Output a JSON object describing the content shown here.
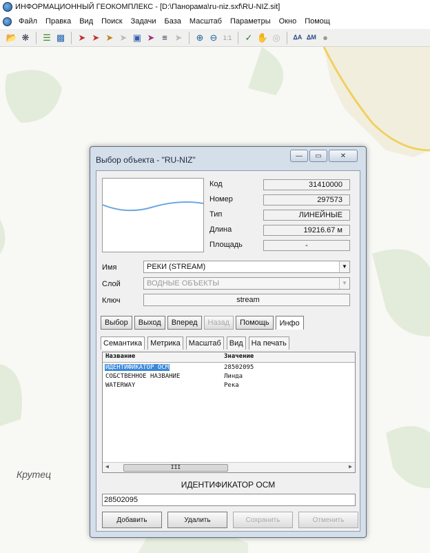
{
  "window": {
    "title": "ИНФОРМАЦИОННЫЙ ГЕОКОМПЛЕКС - [D:\\Панорама\\ru-niz.sxf\\RU-NIZ.sit]",
    "app_icon": "globe-icon"
  },
  "menu": {
    "items": [
      "Файл",
      "Правка",
      "Вид",
      "Поиск",
      "Задачи",
      "База",
      "Масштаб",
      "Параметры",
      "Окно",
      "Помощ"
    ]
  },
  "toolbar": {
    "icons": [
      "open-folder-icon",
      "bug-icon",
      "layers-icon",
      "document-icon",
      "select-arrow-icon",
      "select-multi-icon",
      "select-area-icon",
      "select-disabled-icon",
      "select-rect-icon",
      "select-obj-icon",
      "list-icon",
      "select-off-icon",
      "zoom-in-icon",
      "zoom-out-icon",
      "zoom-actual-icon",
      "check-tool-icon",
      "hand-pan-icon",
      "target-icon",
      "text-tool-icon",
      "measure-tool-icon",
      "circle-icon"
    ],
    "zoom_actual_label": "1:1"
  },
  "map": {
    "place_label": "Крутец",
    "fill_color": "#dfe8d6",
    "road_color": "#f0d060"
  },
  "dialog": {
    "title": "Выбор объекта - \"RU-NIZ\"",
    "controls": {
      "minimize": "—",
      "restore": "▭",
      "close": "✕"
    },
    "props": [
      {
        "label": "Код",
        "value": "31410000"
      },
      {
        "label": "Номер",
        "value": "297573"
      },
      {
        "label": "Тип",
        "value": "ЛИНЕЙНЫЕ"
      },
      {
        "label": "Длина",
        "value": "19216.67 м"
      },
      {
        "label": "Площадь",
        "value": "-"
      }
    ],
    "name_label": "Имя",
    "name_value": "РЕКИ (STREAM)",
    "layer_label": "Слой",
    "layer_value": "ВОДНЫЕ ОБЪЕКТЫ",
    "key_label": "Ключ",
    "key_value": "stream",
    "buttons": {
      "select": "Выбор",
      "exit": "Выход",
      "forward": "Вперед",
      "back": "Назад",
      "help": "Помощь",
      "info": "Инфо"
    },
    "tabs": [
      "Семантика",
      "Метрика",
      "Масштаб",
      "Вид",
      "На печать"
    ],
    "table": {
      "headers": [
        "Название",
        "Значение"
      ],
      "rows": [
        {
          "name": "ИДЕНТИФИКАТОР ОСМ",
          "value": "28502095"
        },
        {
          "name": "СОБСТВЕННОЕ НАЗВАНИЕ",
          "value": "Линда"
        },
        {
          "name": "WATERWAY",
          "value": "Река"
        }
      ],
      "scroll_thumb": "III"
    },
    "selected_attr_name": "ИДЕНТИФИКАТОР ОСМ",
    "selected_attr_value": "28502095",
    "bottom_buttons": {
      "add": "Добавить",
      "delete": "Удалить",
      "save": "Сохранить",
      "cancel": "Отменить"
    }
  }
}
